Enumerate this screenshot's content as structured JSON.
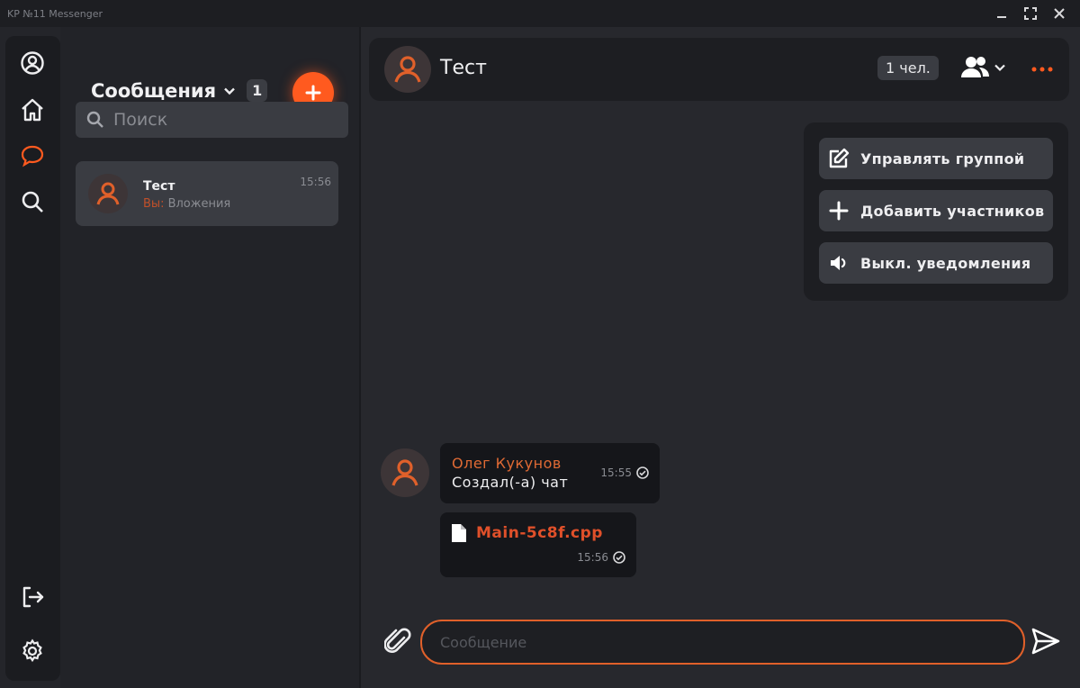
{
  "window": {
    "title": "KP №11 Messenger"
  },
  "colors": {
    "accent": "#ff5a1f",
    "panel": "#1d1e22",
    "card": "#3a3c42",
    "muted": "#8a8c92"
  },
  "rail": {
    "items": [
      "profile-icon",
      "home-icon",
      "chat-icon",
      "search-icon",
      "logout-icon",
      "settings-icon"
    ],
    "active": "chat-icon"
  },
  "sidebar": {
    "title": "Сообщения",
    "count": "1",
    "search_placeholder": "Поиск",
    "chats": [
      {
        "name": "Тест",
        "time": "15:56",
        "preview_prefix": "Вы:",
        "preview": "Вложения"
      }
    ]
  },
  "chat": {
    "title": "Тест",
    "members": "1 чел.",
    "menu": [
      {
        "icon": "edit-icon",
        "label": "Управлять группой"
      },
      {
        "icon": "plus-icon",
        "label": "Добавить участников"
      },
      {
        "icon": "speaker-icon",
        "label": "Выкл. уведомления"
      }
    ],
    "messages": [
      {
        "sender": "Олег Кукунов",
        "text": "Создал(-а) чат",
        "time": "15:55"
      },
      {
        "file": "Main-5c8f.cpp",
        "time": "15:56"
      }
    ],
    "input_placeholder": "Сообщение"
  }
}
